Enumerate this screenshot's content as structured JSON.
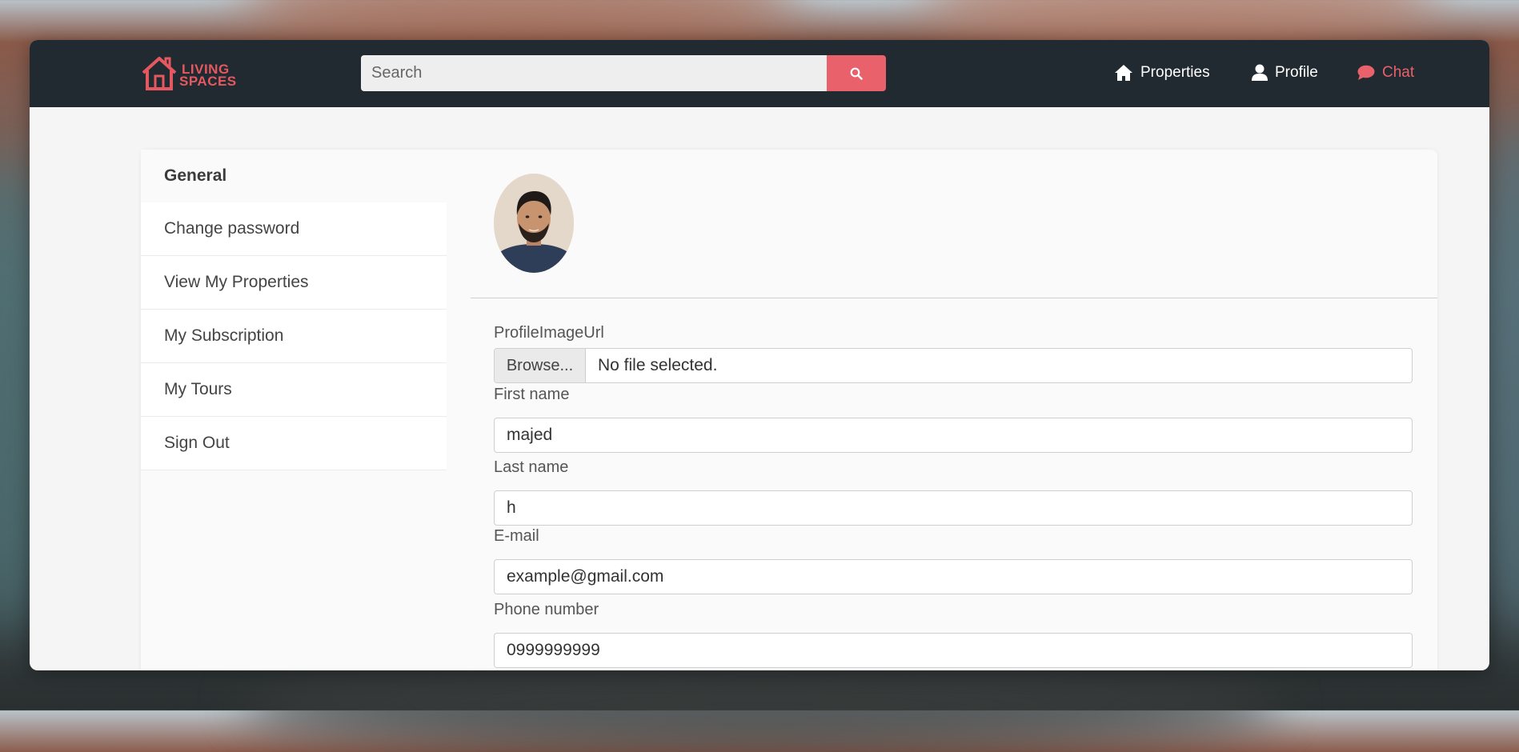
{
  "brand": {
    "line1": "LIVING",
    "line2": "SPACES",
    "color": "#e6585f"
  },
  "search": {
    "placeholder": "Search",
    "value": "",
    "icon": "search-icon"
  },
  "nav": {
    "items": [
      {
        "label": "Properties",
        "icon": "home-icon"
      },
      {
        "label": "Profile",
        "icon": "user-icon"
      },
      {
        "label": "Chat",
        "icon": "chat-bubble-icon",
        "active": true
      }
    ]
  },
  "sidebar": {
    "items": [
      {
        "label": "General",
        "active": true
      },
      {
        "label": "Change password"
      },
      {
        "label": "View My Properties"
      },
      {
        "label": "My Subscription"
      },
      {
        "label": "My Tours"
      },
      {
        "label": "Sign Out"
      }
    ]
  },
  "form": {
    "profile_image": {
      "label": "ProfileImageUrl",
      "browse_label": "Browse...",
      "file_status": "No file selected."
    },
    "first_name": {
      "label": "First name",
      "value": "majed"
    },
    "last_name": {
      "label": "Last name",
      "value": "h"
    },
    "email": {
      "label": "E-mail",
      "value": "example@gmail.com"
    },
    "phone": {
      "label": "Phone number",
      "value": "0999999999"
    }
  },
  "colors": {
    "accent": "#e9616a",
    "navbar": "#212a31",
    "page": "#f5f5f5"
  }
}
